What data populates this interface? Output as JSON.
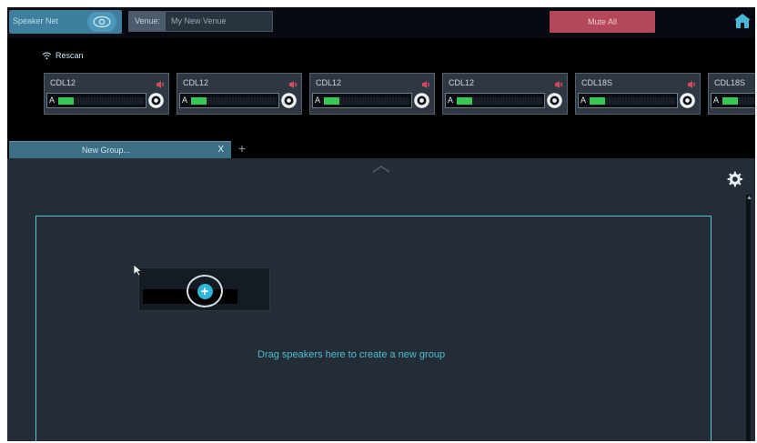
{
  "topbar": {
    "speaker_network_label": "Speaker Net",
    "venue_label": "Venue:",
    "venue_name": "My New Venue",
    "mute_all_label": "Mute All",
    "home_icon": "home-icon"
  },
  "rescan_label": "Rescan",
  "speakers": [
    {
      "name": "CDL12",
      "channel": "A",
      "level": 0.18
    },
    {
      "name": "CDL12",
      "channel": "A",
      "level": 0.18
    },
    {
      "name": "CDL12",
      "channel": "A",
      "level": 0.18
    },
    {
      "name": "CDL12",
      "channel": "A",
      "level": 0.18
    },
    {
      "name": "CDL18S",
      "channel": "A",
      "level": 0.18
    },
    {
      "name": "CDL18S",
      "channel": "A",
      "level": 0.18
    }
  ],
  "group_tab": {
    "label": "New Group...",
    "close": "X"
  },
  "add_tab_label": "+",
  "dropzone": {
    "hint": "Drag speakers here to create a new group"
  },
  "new_group_icon": "plus-icon",
  "colors": {
    "accent": "#3e7f9e",
    "mute": "#b3485a",
    "meter": "#38c85a",
    "dropzone_border": "#59c9d8"
  }
}
